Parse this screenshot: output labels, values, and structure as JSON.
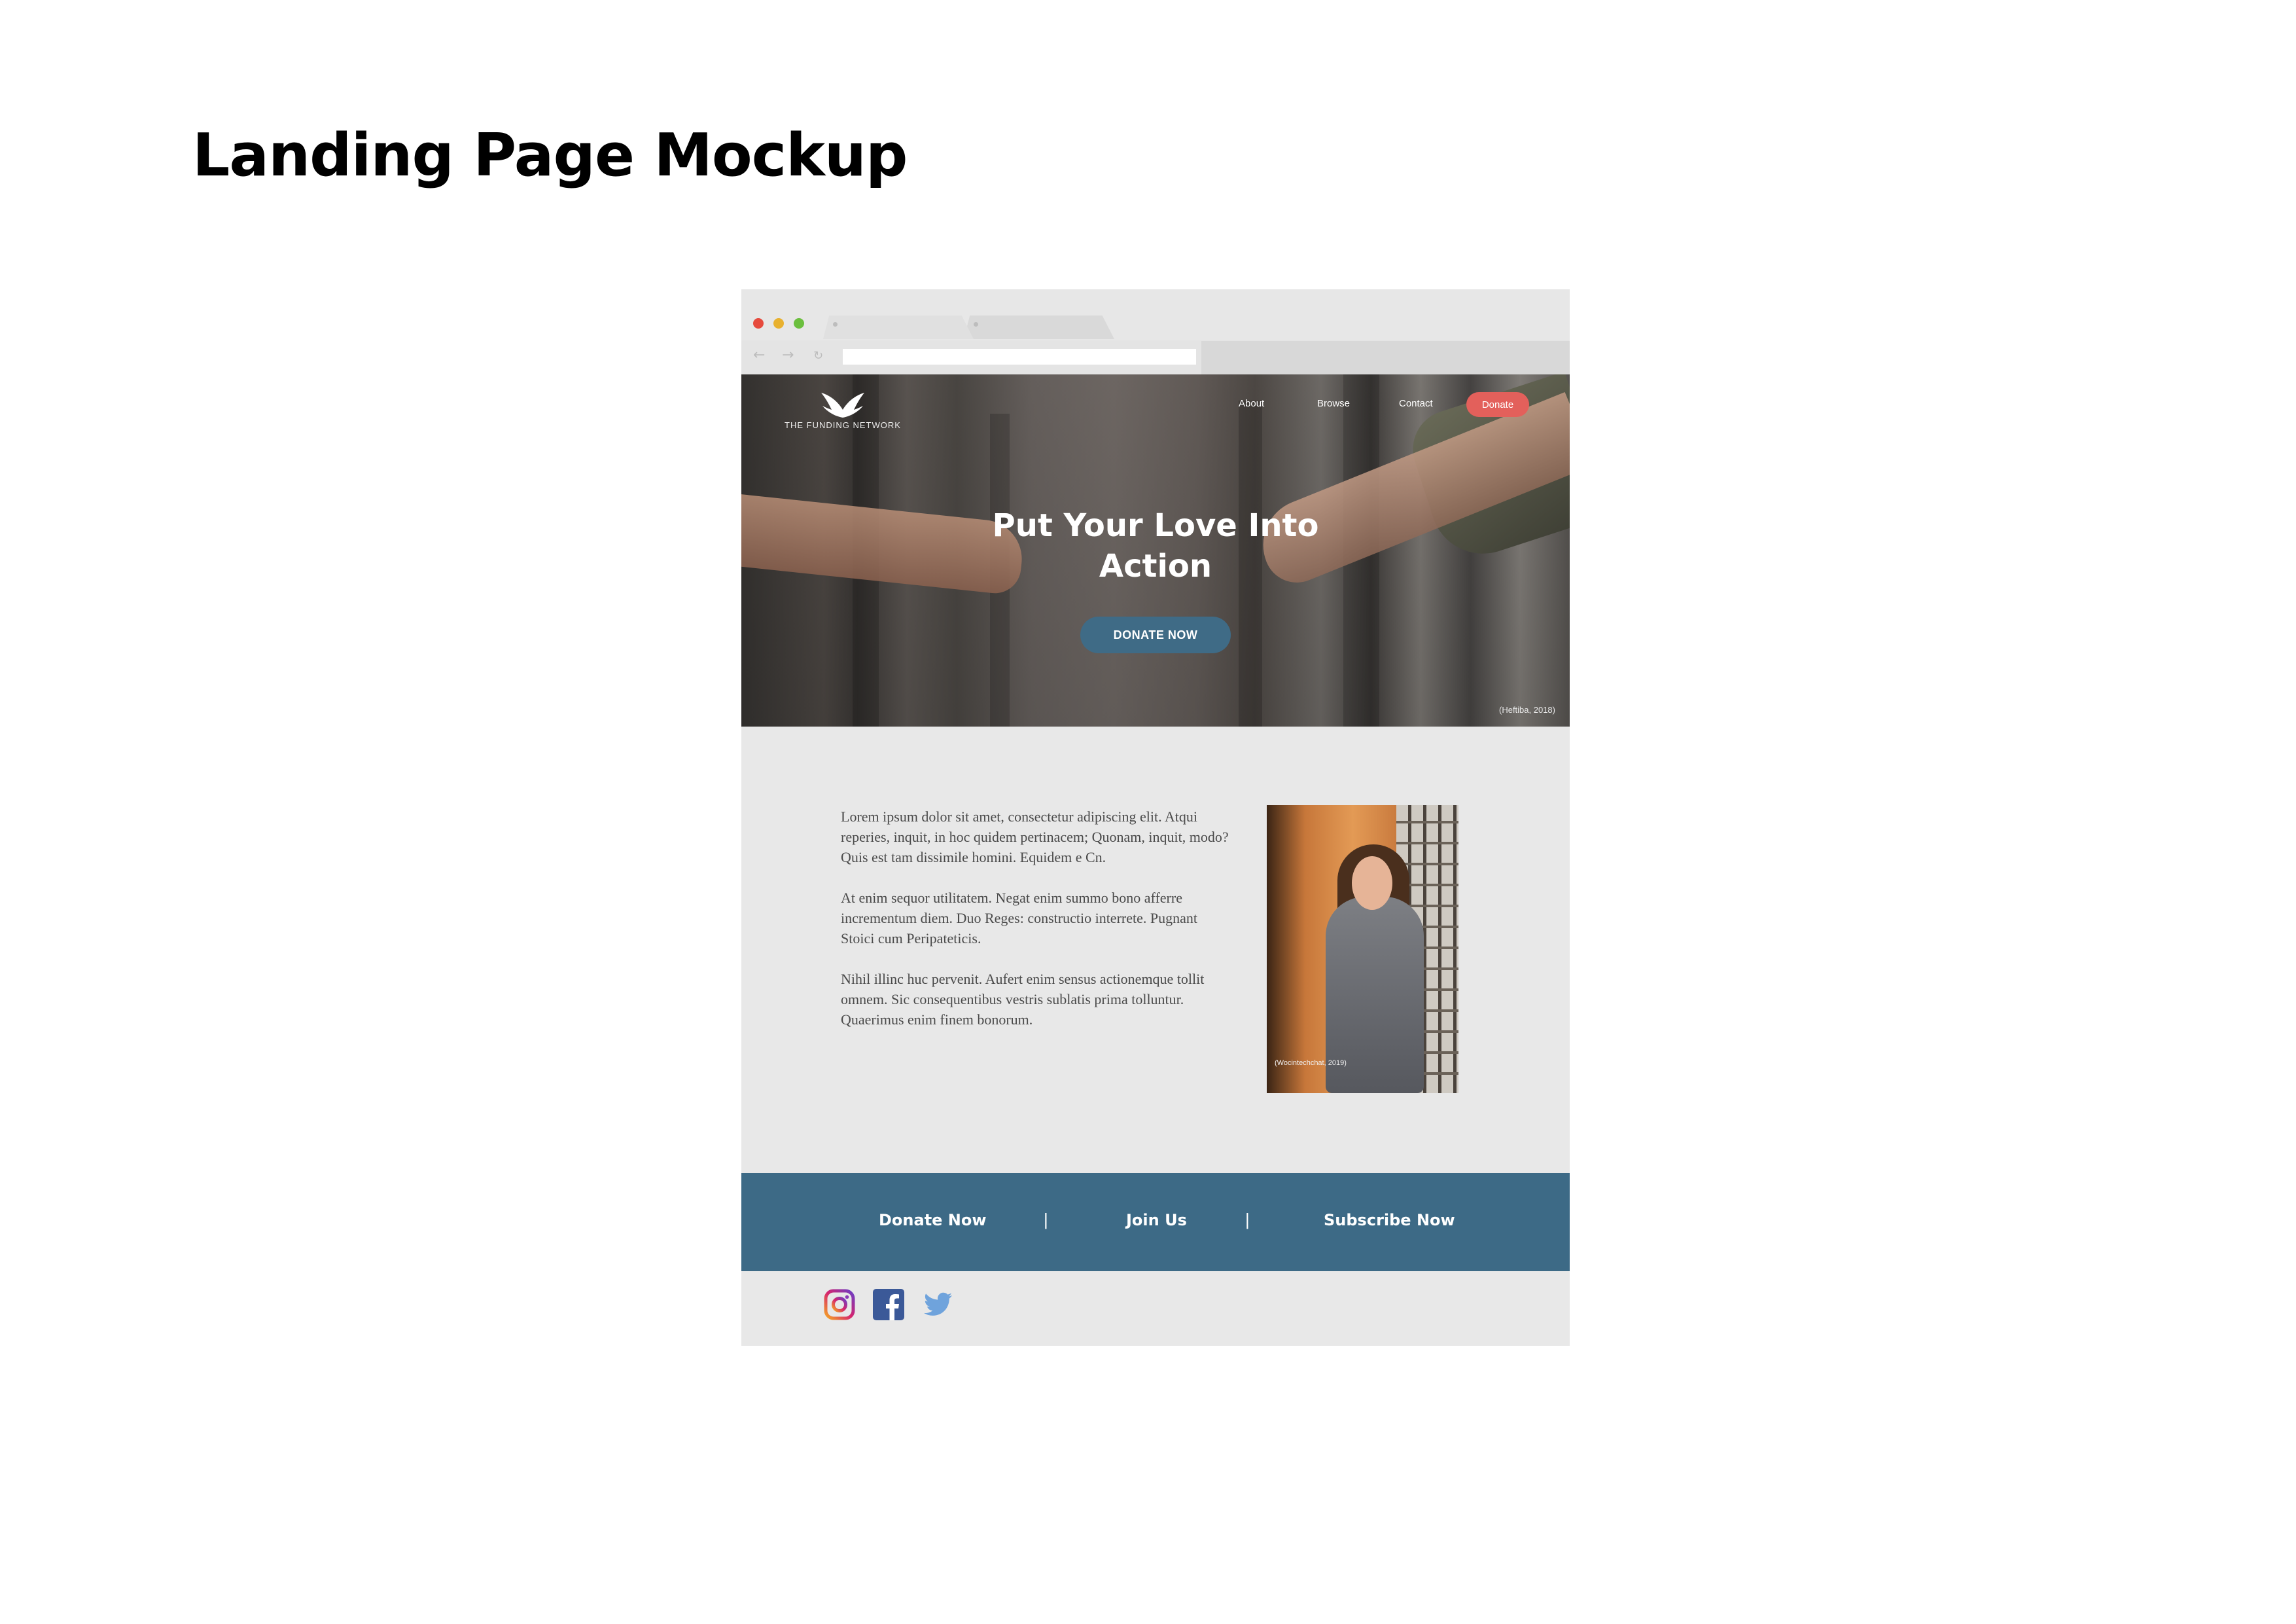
{
  "page": {
    "title": "Landing Page Mockup"
  },
  "site": {
    "brand": "THE FUNDING NETWORK",
    "nav": {
      "about": "About",
      "browse": "Browse",
      "contact": "Contact",
      "donate": "Donate"
    },
    "hero": {
      "headline": "Put Your Love Into Action",
      "cta": "DONATE NOW",
      "credit": "(Heftiba, 2018)"
    },
    "body": {
      "paragraphs": [
        "Lorem ipsum dolor sit amet, consectetur adipiscing elit. Atqui reperies, inquit, in hoc quidem pertinacem; Quonam, inquit, modo? Quis est tam dissimile homini. Equidem e Cn.",
        "At enim sequor utilitatem. Negat enim summo bono afferre incrementum diem. Duo Reges: constructio interrete. Pugnant Stoici cum Peripateticis.",
        "Nihil illinc huc pervenit. Aufert enim sensus actionemque tollit omnem. Sic consequentibus vestris sublatis prima tolluntur. Quaerimus enim finem bonorum."
      ],
      "photo_credit": "(Wocintechchat, 2019)"
    },
    "footer": {
      "donate_now": "Donate Now",
      "join_us": "Join Us",
      "subscribe_now": "Subscribe Now",
      "separator": "|"
    },
    "social": [
      "instagram-icon",
      "facebook-icon",
      "twitter-icon"
    ]
  },
  "colors": {
    "donate_red": "#e3605b",
    "brand_blue": "#3d6a86",
    "content_bg": "#e8e8e8"
  }
}
